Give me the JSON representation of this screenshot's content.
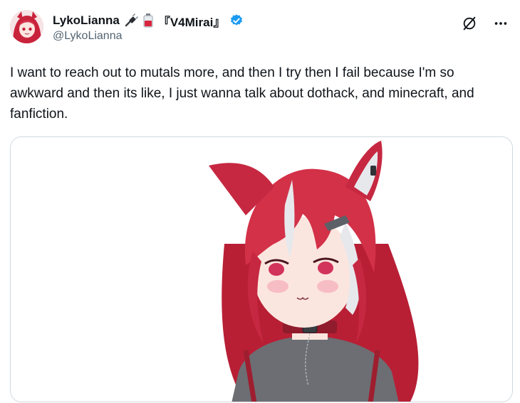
{
  "tweet": {
    "author": {
      "display_name": "LykoLianna",
      "emoji_1": "plug-icon",
      "emoji_2": "battery-jar-icon",
      "tag": "『V4Mirai』",
      "verified": true,
      "handle": "@LykoLianna"
    },
    "text": "I want to reach out to mutals more, and then I try then I fail because I'm so awkward and then its like, I just wanna talk about dothack, and minecraft, and fanfiction.",
    "actions": {
      "grok_icon": "grok-icon",
      "more_icon": "more-icon"
    },
    "media": {
      "type": "image",
      "subject": "anime catgirl illustration"
    },
    "colors": {
      "verified": "#1d9bf0",
      "text": "#0f1419",
      "secondary": "#536471",
      "border": "#cfd9de",
      "hair": "#d33148"
    }
  }
}
